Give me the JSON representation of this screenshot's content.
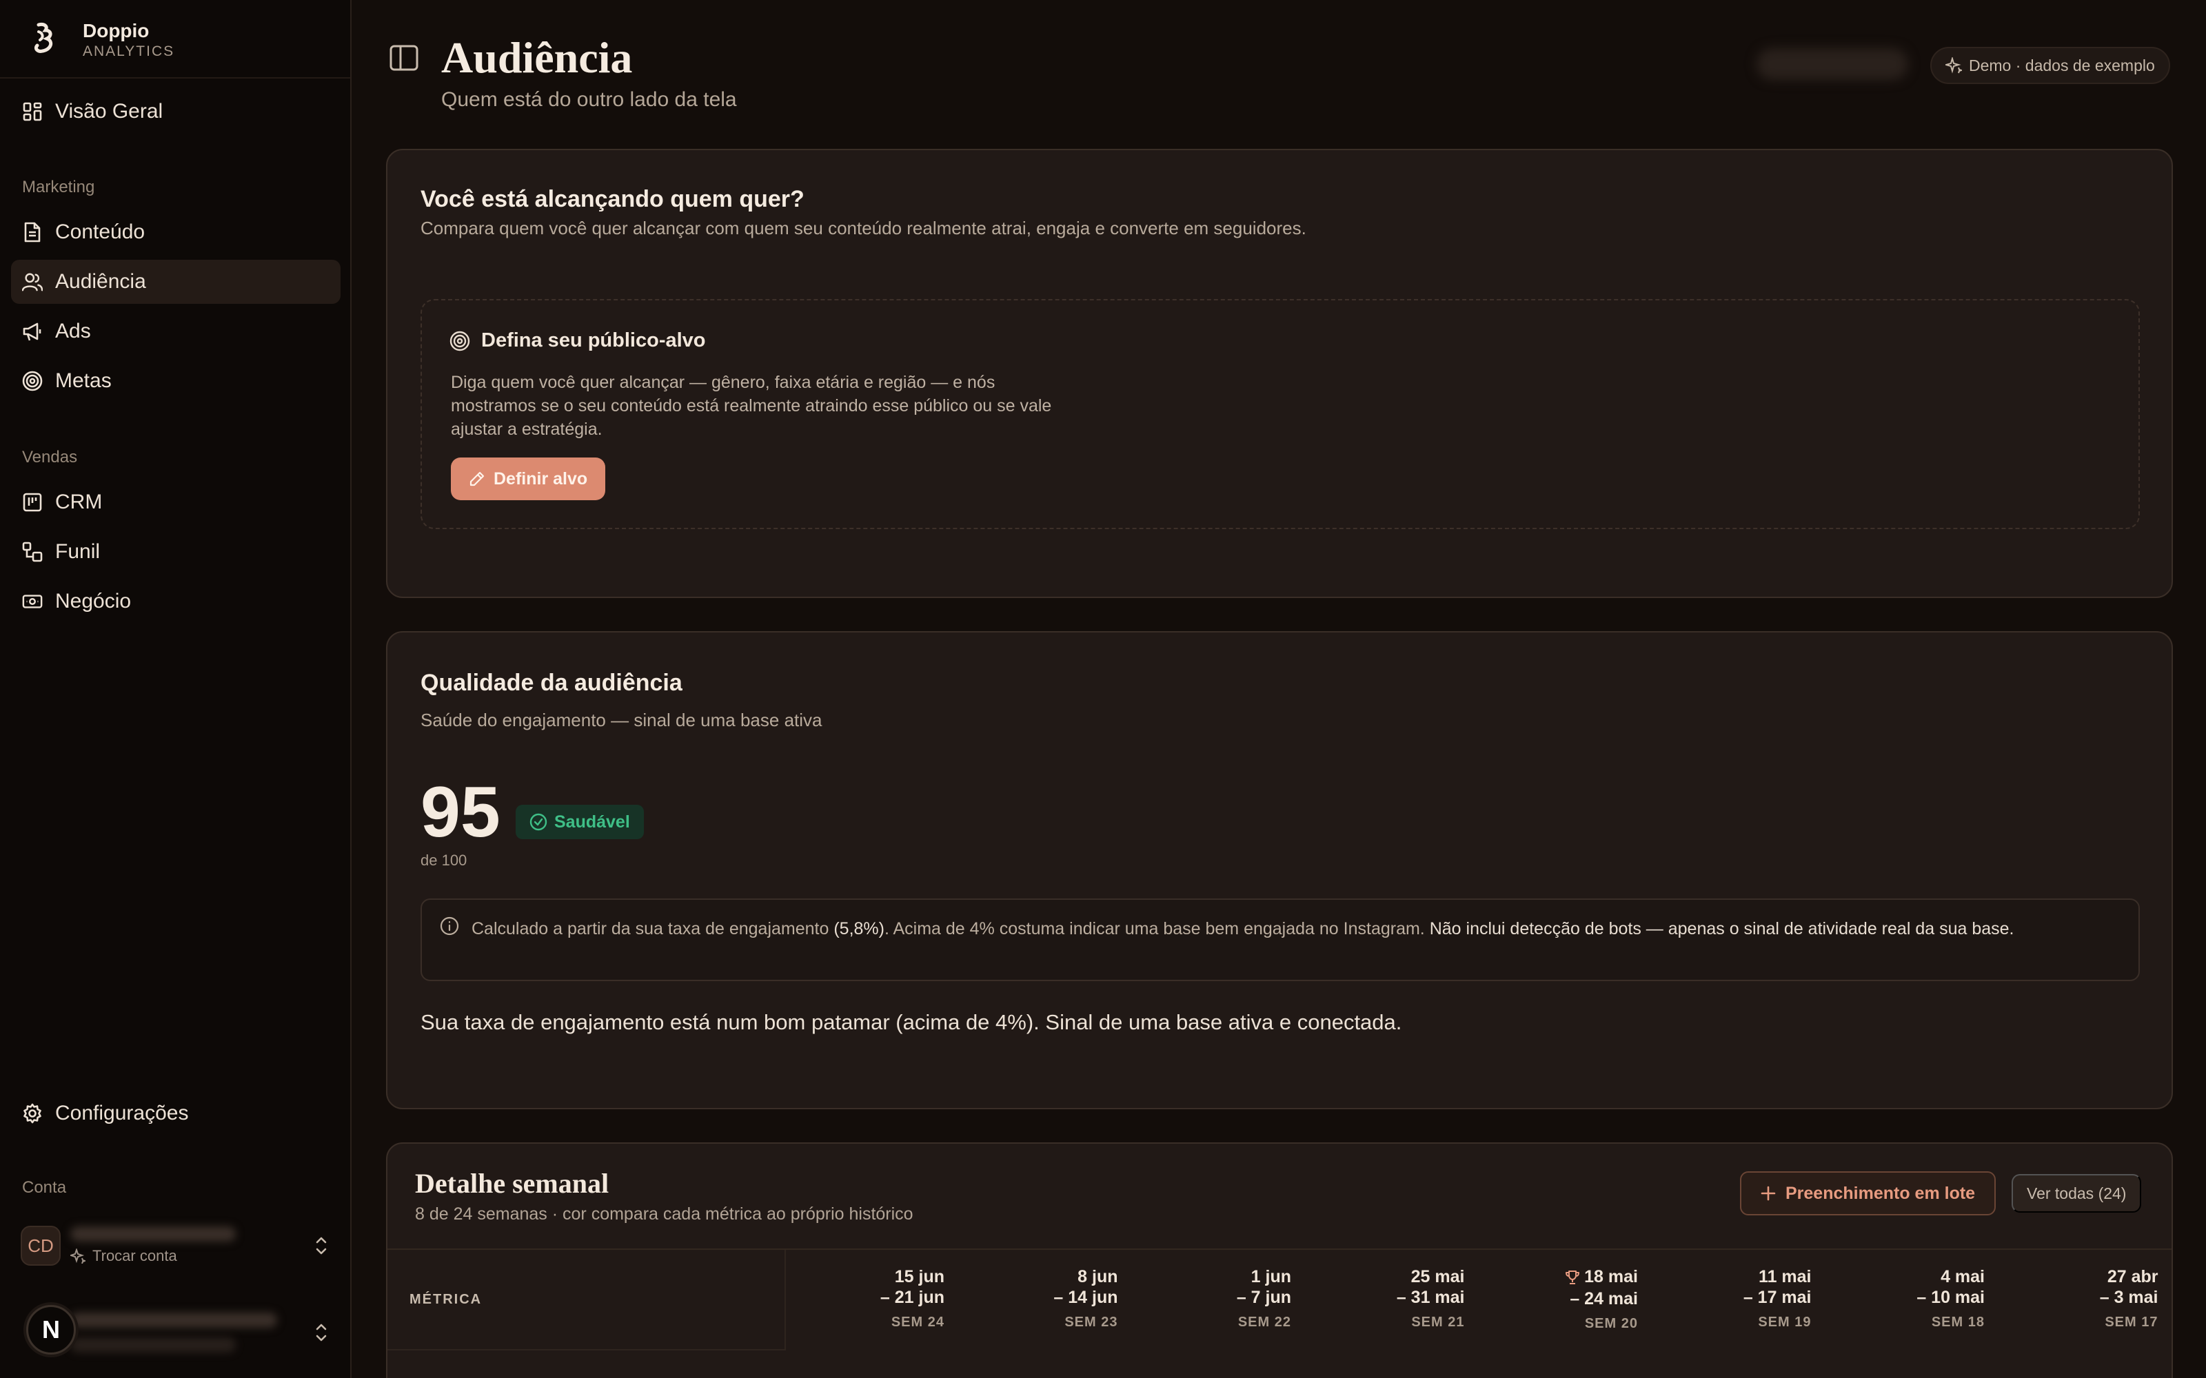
{
  "brand": {
    "name": "Doppio",
    "sub": "ANALYTICS"
  },
  "nav": {
    "overview": "Visão Geral",
    "marketing_label": "Marketing",
    "content": "Conteúdo",
    "audience": "Audiência",
    "ads": "Ads",
    "goals": "Metas",
    "sales_label": "Vendas",
    "crm": "CRM",
    "funnel": "Funil",
    "business": "Negócio",
    "settings": "Configurações"
  },
  "account": {
    "label": "Conta",
    "initials": "CD",
    "switch": "Trocar conta",
    "user_initial": "N"
  },
  "header": {
    "title": "Audiência",
    "subtitle": "Quem está do outro lado da tela",
    "demo_badge": "Demo · dados de exemplo"
  },
  "target_card": {
    "title": "Você está alcançando quem quer?",
    "desc": "Compara quem você quer alcançar com quem seu conteúdo realmente atrai, engaja e converte em seguidores.",
    "box_title": "Defina seu público-alvo",
    "box_text": "Diga quem você quer alcançar — gênero, faixa etária e região — e nós mostramos se o seu conteúdo está realmente atraindo esse público ou se vale ajustar a estratégia.",
    "button": "Definir alvo"
  },
  "quality_card": {
    "title": "Qualidade da audiência",
    "desc": "Saúde do engajamento — sinal de uma base ativa",
    "score": "95",
    "score_of": "de 100",
    "badge": "Saudável",
    "info_a": "Calculado a partir da sua taxa de engajamento ",
    "info_rate": "(5,8%)",
    "info_b": ". Acima de 4% costuma indicar uma base bem engajada no Instagram. ",
    "info_c": "Não inclui detecção de bots — apenas o sinal de atividade real da sua base.",
    "verdict": "Sua taxa de engajamento está num bom patamar (acima de 4%). Sinal de uma base ativa e conectada."
  },
  "weekly": {
    "title": "Detalhe semanal",
    "subtitle": "8 de 24 semanas · cor compara cada métrica ao próprio histórico",
    "batch_button": "Preenchimento em lote",
    "view_all": "Ver todas (24)",
    "metric_header": "MÉTRICA",
    "weeks": [
      {
        "d1": "15 jun",
        "d2": "– 21 jun",
        "sem": "SEM 24",
        "best": false
      },
      {
        "d1": "8 jun",
        "d2": "– 14 jun",
        "sem": "SEM 23",
        "best": false
      },
      {
        "d1": "1 jun",
        "d2": "– 7 jun",
        "sem": "SEM 22",
        "best": false
      },
      {
        "d1": "25 mai",
        "d2": "– 31 mai",
        "sem": "SEM 21",
        "best": false
      },
      {
        "d1": "18 mai",
        "d2": "– 24 mai",
        "sem": "SEM 20",
        "best": true
      },
      {
        "d1": "11 mai",
        "d2": "– 17 mai",
        "sem": "SEM 19",
        "best": false
      },
      {
        "d1": "4 mai",
        "d2": "– 10 mai",
        "sem": "SEM 18",
        "best": false
      },
      {
        "d1": "27 abr",
        "d2": "– 3 mai",
        "sem": "SEM 17",
        "best": false
      }
    ]
  },
  "colors": {
    "accent": "#dc8a70",
    "healthy": "#3fbf87",
    "background": "#130d0a",
    "card": "#211916"
  }
}
